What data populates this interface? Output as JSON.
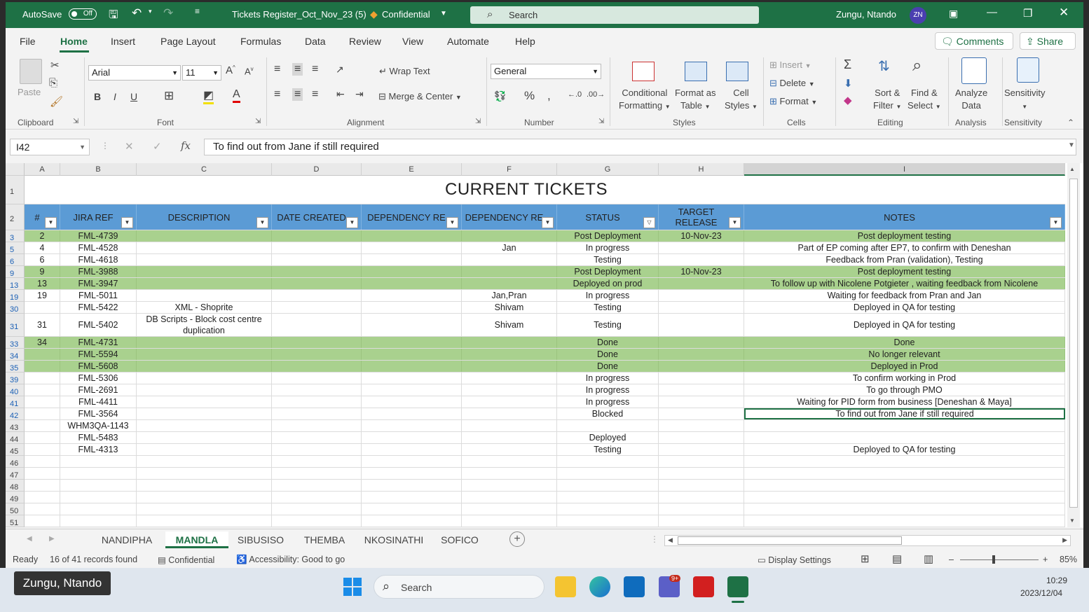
{
  "titlebar": {
    "autosave": "AutoSave",
    "autosave_state": "Off",
    "filename": "Tickets Register_Oct_Nov_23 (5)",
    "sensitivity": "Confidential",
    "search": "Search",
    "user": "Zungu, Ntando",
    "initials": "ZN"
  },
  "menu": {
    "items": [
      "File",
      "Home",
      "Insert",
      "Page Layout",
      "Formulas",
      "Data",
      "Review",
      "View",
      "Automate",
      "Help"
    ],
    "comments": "Comments",
    "share": "Share"
  },
  "ribbon": {
    "paste": "Paste",
    "font_name": "Arial",
    "font_size": "11",
    "wrap_text": "Wrap Text",
    "merge_center": "Merge & Center",
    "number_format": "General",
    "conditional_formatting": [
      "Conditional",
      "Formatting"
    ],
    "format_as_table": [
      "Format as",
      "Table"
    ],
    "cell_styles": [
      "Cell",
      "Styles"
    ],
    "insert": "Insert",
    "delete": "Delete",
    "format": "Format",
    "sort_filter": [
      "Sort &",
      "Filter"
    ],
    "find_select": [
      "Find &",
      "Select"
    ],
    "analyze_data": [
      "Analyze",
      "Data"
    ],
    "sensitivity": "Sensitivity",
    "groups": [
      "Clipboard",
      "Font",
      "Alignment",
      "Number",
      "Styles",
      "Cells",
      "Editing",
      "Analysis",
      "Sensitivity"
    ]
  },
  "formula_bar": {
    "name_box": "I42",
    "formula": "To find out from Jane if still required"
  },
  "columns": [
    "A",
    "B",
    "C",
    "D",
    "E",
    "F",
    "G",
    "H",
    "I"
  ],
  "sheet": {
    "title": "CURRENT TICKETS",
    "headers": [
      "#",
      "JIRA REF",
      "DESCRIPTION",
      "DATE CREATED",
      "DEPENDENCY REF",
      "DEPENDENCY RE",
      "STATUS",
      "TARGET RELEASE",
      "NOTES"
    ],
    "header_display": [
      "#",
      "JIRA REF",
      "DESCRIPTION",
      "DATE CREATED",
      "DEPENDENCY RE",
      "DEPENDENCY RE",
      "STATUS",
      "TARGET\nRELEASE",
      "NOTES"
    ],
    "rows": [
      {
        "rn": "3",
        "green": true,
        "cells": [
          "2",
          "FML-4739",
          "",
          "",
          "",
          "",
          "Post Deployment",
          "10-Nov-23",
          "Post deployment testing"
        ]
      },
      {
        "rn": "5",
        "green": false,
        "cells": [
          "4",
          "FML-4528",
          "",
          "",
          "",
          "Jan",
          "In progress",
          "",
          "Part of EP coming after EP7, to confirm with Deneshan"
        ]
      },
      {
        "rn": "6",
        "green": false,
        "cells": [
          "6",
          "FML-4618",
          "",
          "",
          "",
          "",
          "Testing",
          "",
          "Feedback from Pran (validation), Testing"
        ]
      },
      {
        "rn": "9",
        "green": true,
        "cells": [
          "9",
          "FML-3988",
          "",
          "",
          "",
          "",
          "Post Deployment",
          "10-Nov-23",
          "Post deployment testing"
        ]
      },
      {
        "rn": "13",
        "green": true,
        "cells": [
          "13",
          "FML-3947",
          "",
          "",
          "",
          "",
          "Deployed on prod",
          "",
          "To follow up with Nicolene Potgieter , waiting feedback from Nicolene"
        ]
      },
      {
        "rn": "19",
        "green": false,
        "cells": [
          "19",
          "FML-5011",
          "",
          "",
          "",
          "Jan,Pran",
          "In progress",
          "",
          "Waiting for feedback from Pran and Jan"
        ]
      },
      {
        "rn": "30",
        "green": false,
        "cells": [
          "",
          "FML-5422",
          "XML - Shoprite",
          "",
          "",
          "Shivam",
          "Testing",
          "",
          "Deployed in QA for testing"
        ]
      },
      {
        "rn": "31",
        "green": false,
        "tall": true,
        "cells": [
          "31",
          "FML-5402",
          "DB Scripts - Block cost centre duplication",
          "",
          "",
          "Shivam",
          "Testing",
          "",
          "Deployed in QA for testing"
        ]
      },
      {
        "rn": "33",
        "green": true,
        "cells": [
          "34",
          "FML-4731",
          "",
          "",
          "",
          "",
          "Done",
          "",
          "Done"
        ]
      },
      {
        "rn": "34",
        "green": true,
        "cells": [
          "",
          "FML-5594",
          "",
          "",
          "",
          "",
          "Done",
          "",
          "No longer relevant"
        ]
      },
      {
        "rn": "35",
        "green": true,
        "cells": [
          "",
          "FML-5608",
          "",
          "",
          "",
          "",
          "Done",
          "",
          "Deployed in Prod"
        ]
      },
      {
        "rn": "39",
        "green": false,
        "cells": [
          "",
          "FML-5306",
          "",
          "",
          "",
          "",
          "In progress",
          "",
          "To confirm working in Prod"
        ]
      },
      {
        "rn": "40",
        "green": false,
        "cells": [
          "",
          "FML-2691",
          "",
          "",
          "",
          "",
          "In progress",
          "",
          "To go through PMO"
        ]
      },
      {
        "rn": "41",
        "green": false,
        "cells": [
          "",
          "FML-4411",
          "",
          "",
          "",
          "",
          "In progress",
          "",
          "Waiting for PID form from business [Deneshan & Maya]"
        ]
      },
      {
        "rn": "42",
        "green": false,
        "selected": true,
        "cells": [
          "",
          "FML-3564",
          "",
          "",
          "",
          "",
          "Blocked",
          "",
          "To find out from Jane if still required"
        ]
      },
      {
        "rn": "43",
        "green": false,
        "cells": [
          "",
          "WHM3QA-1143",
          "",
          "",
          "",
          "",
          "",
          "",
          ""
        ]
      },
      {
        "rn": "44",
        "green": false,
        "cells": [
          "",
          "FML-5483",
          "",
          "",
          "",
          "",
          "Deployed",
          "",
          ""
        ]
      },
      {
        "rn": "45",
        "green": false,
        "cells": [
          "",
          "FML-4313",
          "",
          "",
          "",
          "",
          "Testing",
          "",
          "Deployed to QA for testing"
        ]
      },
      {
        "rn": "46",
        "green": false,
        "cells": [
          "",
          "",
          "",
          "",
          "",
          "",
          "",
          "",
          ""
        ]
      },
      {
        "rn": "47",
        "green": false,
        "cells": [
          "",
          "",
          "",
          "",
          "",
          "",
          "",
          "",
          ""
        ]
      },
      {
        "rn": "48",
        "green": false,
        "cells": [
          "",
          "",
          "",
          "",
          "",
          "",
          "",
          "",
          ""
        ]
      },
      {
        "rn": "49",
        "green": false,
        "cells": [
          "",
          "",
          "",
          "",
          "",
          "",
          "",
          "",
          ""
        ]
      },
      {
        "rn": "50",
        "green": false,
        "cells": [
          "",
          "",
          "",
          "",
          "",
          "",
          "",
          "",
          ""
        ]
      },
      {
        "rn": "51",
        "green": false,
        "cells": [
          "",
          "",
          "",
          "",
          "",
          "",
          "",
          "",
          ""
        ]
      }
    ]
  },
  "tabs": [
    "NANDIPHA",
    "MANDLA",
    "SIBUSISO",
    "THEMBA",
    "NKOSINATHI",
    "SOFICO"
  ],
  "active_tab": "MANDLA",
  "status": {
    "ready": "Ready",
    "records": "16 of 41 records found",
    "confidential": "Confidential",
    "accessibility": "Accessibility: Good to go",
    "display_settings": "Display Settings",
    "zoom": "85%"
  },
  "taskbar": {
    "user_label": "Zungu, Ntando",
    "search": "Search",
    "teams_badge": "9+",
    "time": "10:29",
    "date": "2023/12/04"
  },
  "colors": {
    "excel_green": "#1e7145",
    "header_blue": "#5b9bd5",
    "row_green": "#a9d18e"
  }
}
